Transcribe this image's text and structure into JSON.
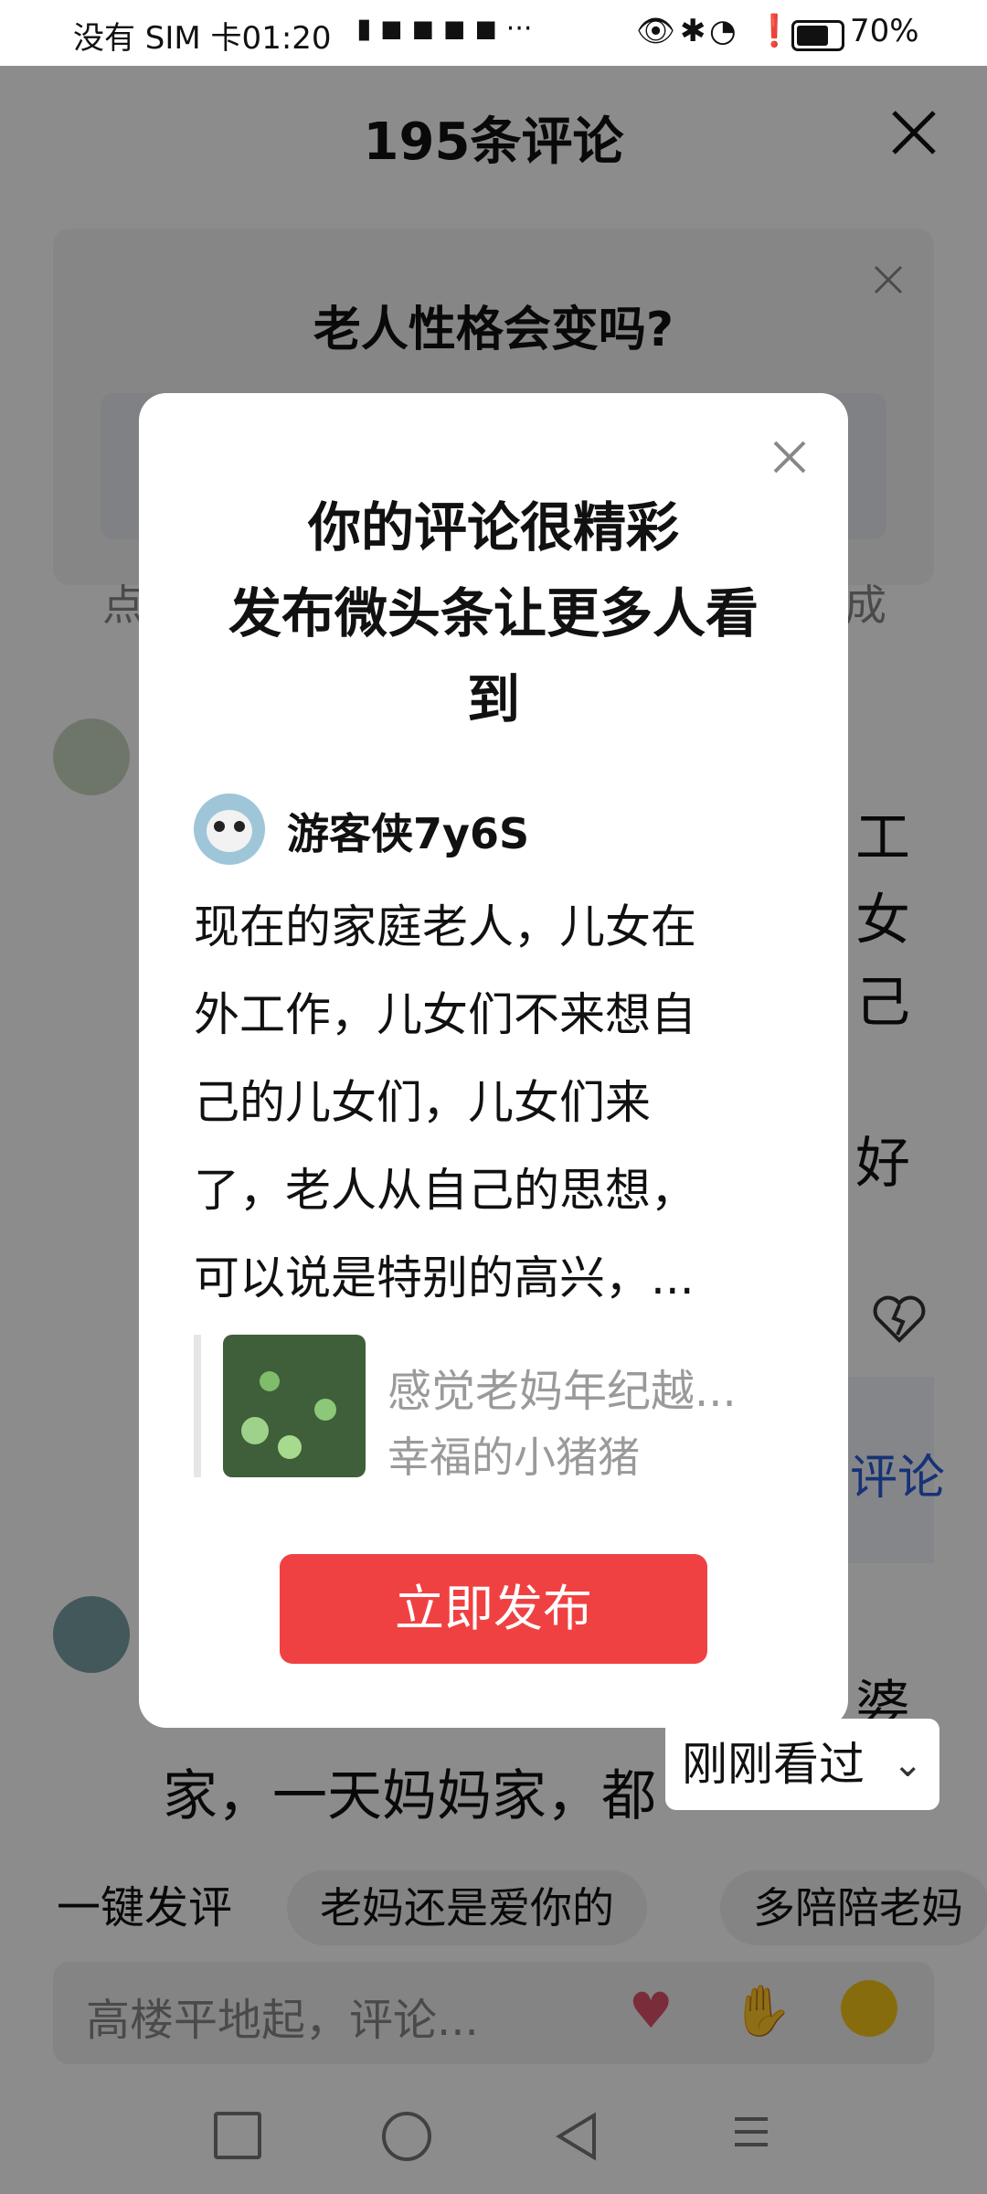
{
  "status_bar": {
    "left": "没有 SIM 卡01:20",
    "battery": "70%"
  },
  "background": {
    "comments_title": "195条评论",
    "article_question": "老人性格会变吗?",
    "peek_left_1": "点",
    "peek_right_1": "成",
    "peek_right_lines": [
      "工",
      "女",
      "己",
      "好"
    ],
    "peek_reply": "评论",
    "peek_bottom_line": "家，一天妈妈家，都",
    "peek_bottom_right": "婆",
    "recently_viewed": "刚刚看过",
    "quick_label": "一键发评",
    "chips": [
      "老妈还是爱你的",
      "多陪陪老妈"
    ],
    "input_placeholder": "高楼平地起，评论...",
    "emoji_icons": [
      "finger-heart-icon",
      "pray-hands-icon",
      "grin-icon"
    ]
  },
  "modal": {
    "title_line1": "你的评论很精彩",
    "title_line2": "发布微头条让更多人看",
    "title_line3": "到",
    "username": "游客侠7y6S",
    "body_lines": [
      "现在的家庭老人，儿女在",
      "外工作，儿女们不来想自",
      "己的儿女们，儿女们来",
      "了，老人从自己的思想，",
      "可以说是特别的高兴，..."
    ],
    "quote_title": "感觉老妈年纪越...",
    "quote_author": "幸福的小猪猪",
    "publish_button": "立即发布"
  },
  "colors": {
    "accent": "#f04142",
    "link": "#2a5bd7"
  }
}
